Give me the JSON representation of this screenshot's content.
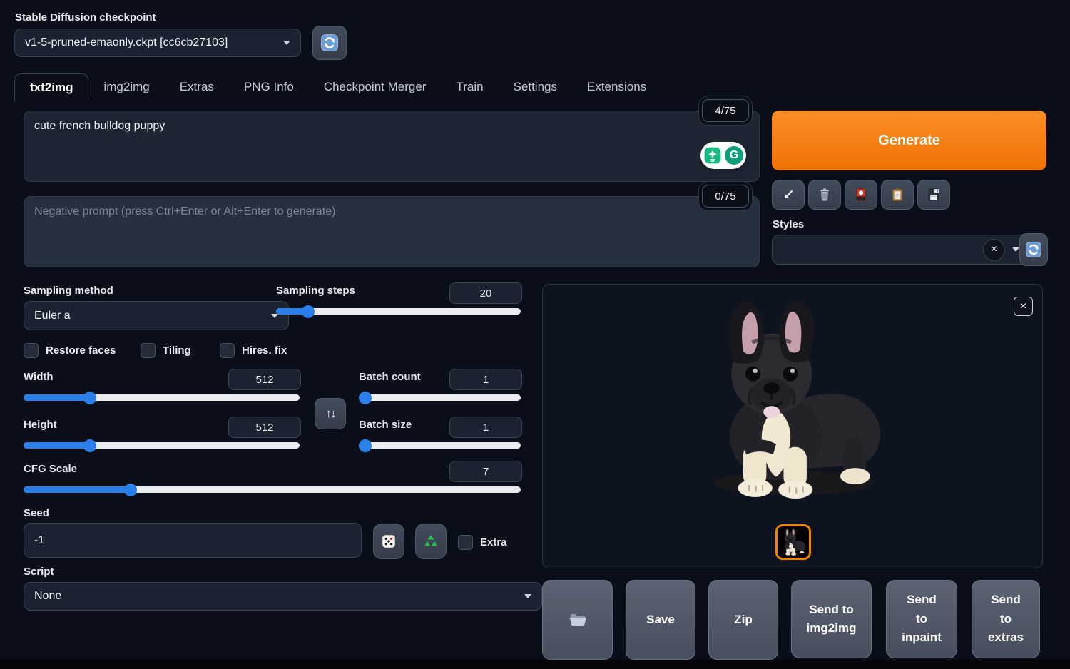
{
  "header": {
    "checkpoint_label": "Stable Diffusion checkpoint",
    "checkpoint_value": "v1-5-pruned-emaonly.ckpt [cc6cb27103]"
  },
  "tabs": [
    {
      "label": "txt2img",
      "active": true
    },
    {
      "label": "img2img",
      "active": false
    },
    {
      "label": "Extras",
      "active": false
    },
    {
      "label": "PNG Info",
      "active": false
    },
    {
      "label": "Checkpoint Merger",
      "active": false
    },
    {
      "label": "Train",
      "active": false
    },
    {
      "label": "Settings",
      "active": false
    },
    {
      "label": "Extensions",
      "active": false
    }
  ],
  "prompt": {
    "value": "cute french bulldog puppy",
    "counter": "4/75"
  },
  "negative_prompt": {
    "placeholder": "Negative prompt (press Ctrl+Enter or Alt+Enter to generate)",
    "counter": "0/75"
  },
  "generate": {
    "label": "Generate"
  },
  "styles": {
    "label": "Styles"
  },
  "sampling": {
    "method_label": "Sampling method",
    "method_value": "Euler a",
    "steps_label": "Sampling steps",
    "steps_value": "20"
  },
  "checkboxes": [
    {
      "label": "Restore faces",
      "checked": false
    },
    {
      "label": "Tiling",
      "checked": false
    },
    {
      "label": "Hires. fix",
      "checked": false
    }
  ],
  "dims": {
    "width_label": "Width",
    "width_value": "512",
    "height_label": "Height",
    "height_value": "512",
    "batch_count_label": "Batch count",
    "batch_count_value": "1",
    "batch_size_label": "Batch size",
    "batch_size_value": "1"
  },
  "cfg": {
    "label": "CFG Scale",
    "value": "7"
  },
  "seed": {
    "label": "Seed",
    "value": "-1",
    "extra_label": "Extra"
  },
  "script": {
    "label": "Script",
    "value": "None"
  },
  "output_actions": {
    "save": "Save",
    "zip": "Zip",
    "send_img2img": "Send to img2img",
    "send_inpaint": "Send to inpaint",
    "send_extras": "Send to extras"
  },
  "output": {
    "image_description": "generated photo of a cute black french bulldog puppy with white chest and paws"
  },
  "icons": {
    "checkpoint_refresh": "circular-arrows-blue",
    "paste_params": "arrow-down-left",
    "clear_prompt": "trash-can",
    "extra_networks": "flower-playing-card",
    "apply_style": "clipboard",
    "save_style": "floppy-disk",
    "styles_clear": "x-in-circle",
    "styles_refresh": "circular-arrows-blue",
    "swap_dimensions": "up-down-arrows",
    "random_seed": "dice",
    "reuse_seed": "recycle",
    "grammarly_assistant": "grammarly-pill",
    "close_gallery": "x",
    "open_folder": "folder"
  },
  "colors": {
    "accent_orange": "#f97d08",
    "accent_blue": "#2a7fe8",
    "page_bg": "#0a0e18",
    "panel_bg": "#1b2230",
    "slider_track": "#e9ebef",
    "thumbnail_border": "#f08300"
  }
}
